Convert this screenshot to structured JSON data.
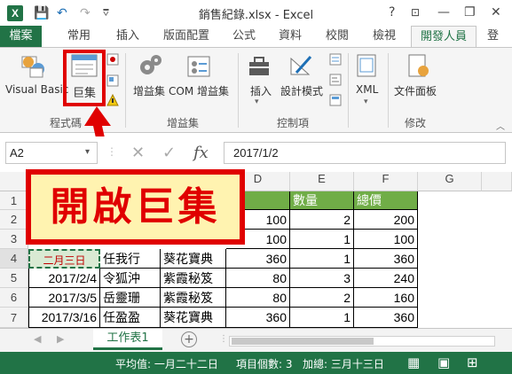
{
  "window": {
    "title": "銷售紀錄.xlsx - Excel",
    "logo": "X",
    "help": "?",
    "min": "—",
    "restore": "❐",
    "close": "✕"
  },
  "qat": {
    "save": "💾",
    "undo": "↶",
    "redo": "↷",
    "customize": "⩢"
  },
  "tabs": [
    {
      "label": "檔案"
    },
    {
      "label": "常用"
    },
    {
      "label": "插入"
    },
    {
      "label": "版面配置"
    },
    {
      "label": "公式"
    },
    {
      "label": "資料"
    },
    {
      "label": "校閱"
    },
    {
      "label": "檢視"
    },
    {
      "label": "開發人員"
    },
    {
      "label": "登"
    }
  ],
  "ribbon": {
    "code": {
      "visual_basic": "Visual Basic",
      "macros": "巨集",
      "group": "程式碼"
    },
    "addins": {
      "addins": "增益集",
      "com_addins": "COM 增益集",
      "group": "增益集"
    },
    "controls": {
      "insert": "插入",
      "design_mode": "設計模式",
      "group": "控制項"
    },
    "xml": {
      "xml": "XML"
    },
    "modify": {
      "doc_panel": "文件面板",
      "group": "修改"
    }
  },
  "formula_bar": {
    "name_box": "A2",
    "cancel": "✕",
    "enter": "✓",
    "fx": "fx",
    "value": "2017/1/2"
  },
  "columns": [
    "D",
    "E",
    "F",
    "G"
  ],
  "rows": [
    "1",
    "2",
    "3",
    "4",
    "5",
    "6",
    "7"
  ],
  "table": {
    "headers": {
      "E": "數量",
      "F": "總價"
    },
    "rows": [
      {
        "A": "",
        "B": "",
        "C": "",
        "D": "100",
        "E": "2",
        "F": "200"
      },
      {
        "A": "",
        "B": "",
        "C": "",
        "D": "100",
        "E": "1",
        "F": "100"
      },
      {
        "A": "二月三日",
        "B": "任我行",
        "C": "葵花寶典",
        "D": "360",
        "E": "1",
        "F": "360"
      },
      {
        "A": "2017/2/4",
        "B": "令狐沖",
        "C": "紫霞秘笈",
        "D": "80",
        "E": "3",
        "F": "240"
      },
      {
        "A": "2017/3/5",
        "B": "岳靈珊",
        "C": "紫霞秘笈",
        "D": "80",
        "E": "2",
        "F": "160"
      },
      {
        "A": "2017/3/16",
        "B": "任盈盈",
        "C": "葵花寶典",
        "D": "360",
        "E": "1",
        "F": "360"
      }
    ]
  },
  "sheets": {
    "active": "工作表1",
    "add": "+"
  },
  "status": {
    "average": "平均值: 一月二十二日",
    "count": "項目個數: 3",
    "sum": "加總: 三月十三日"
  },
  "annotation": {
    "text": "開啟巨集"
  },
  "colors": {
    "excel_green": "#217346",
    "header_green": "#70ad47",
    "highlight_red": "#e00000",
    "callout_fill": "#fff3b0"
  }
}
